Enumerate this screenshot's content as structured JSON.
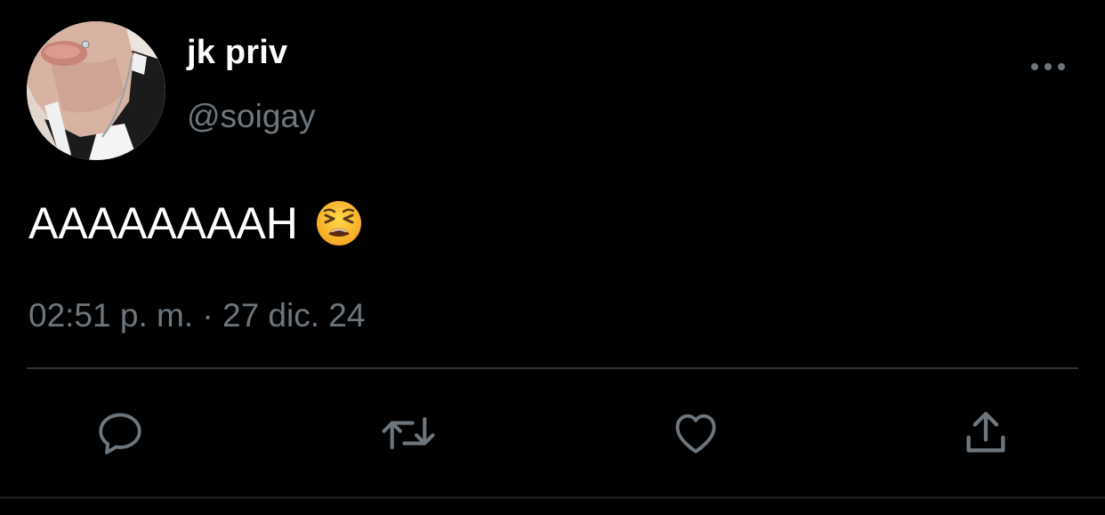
{
  "tweet": {
    "display_name": "jk priv",
    "handle": "@soigay",
    "text": "AAAAAAAAH",
    "emoji": "tired-face",
    "timestamp": "02:51 p. m. · 27 dic. 24"
  },
  "actions": [
    {
      "name": "reply",
      "icon": "reply-icon"
    },
    {
      "name": "retweet",
      "icon": "retweet-icon"
    },
    {
      "name": "like",
      "icon": "heart-icon"
    },
    {
      "name": "share",
      "icon": "share-icon"
    }
  ],
  "colors": {
    "background": "#000000",
    "primary_text": "#ffffff",
    "secondary_text": "#6e767d",
    "divider": "#2f3336"
  }
}
